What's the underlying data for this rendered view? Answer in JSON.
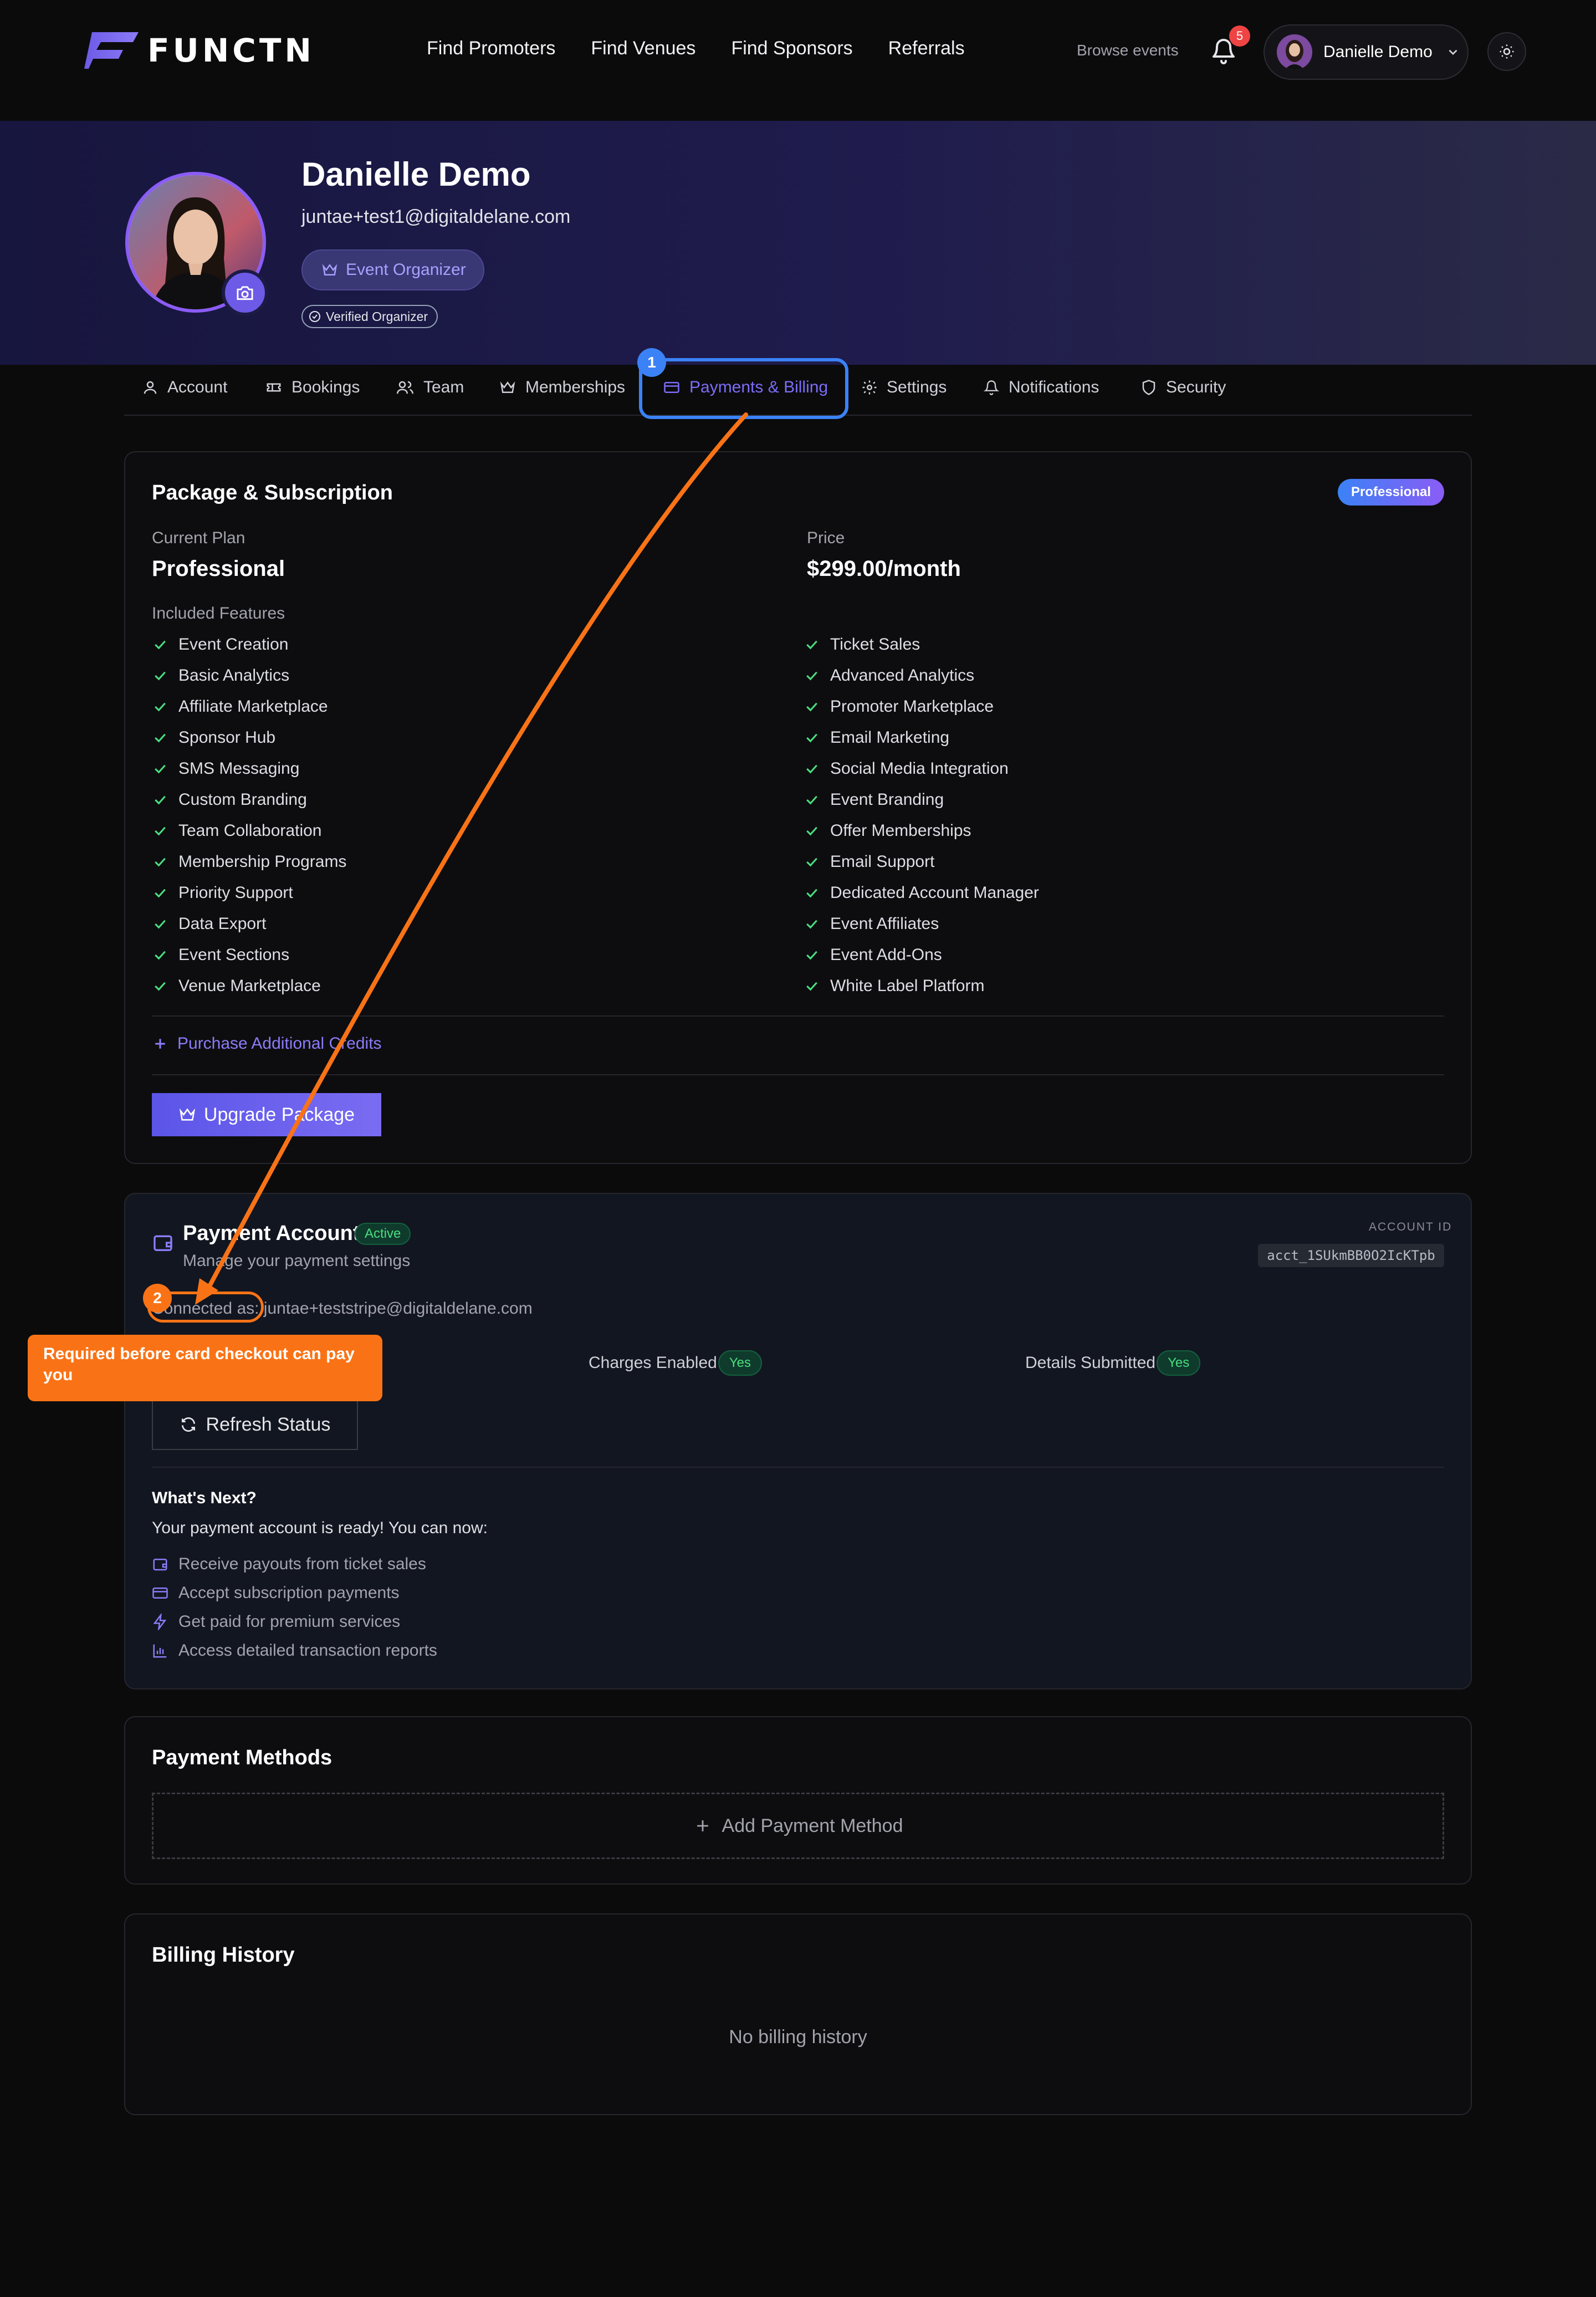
{
  "brand": {
    "name": "FUNCTN"
  },
  "nav": {
    "links": [
      "Find Promoters",
      "Find Venues",
      "Find Sponsors",
      "Referrals"
    ],
    "browse": "Browse events",
    "notifications_count": "5",
    "user_name": "Danielle Demo"
  },
  "profile": {
    "name": "Danielle Demo",
    "email": "juntae+test1@digitaldelane.com",
    "role": "Event Organizer",
    "verified": "Verified Organizer"
  },
  "tabs": [
    "Account",
    "Bookings",
    "Team",
    "Memberships",
    "Payments & Billing",
    "Settings",
    "Notifications",
    "Security"
  ],
  "active_tab": "Payments & Billing",
  "package": {
    "title": "Package & Subscription",
    "badge": "Professional",
    "current_plan_label": "Current Plan",
    "current_plan": "Professional",
    "price_label": "Price",
    "price": "$299.00/month",
    "features_label": "Included Features",
    "features_left": [
      "Event Creation",
      "Basic Analytics",
      "Affiliate Marketplace",
      "Sponsor Hub",
      "SMS Messaging",
      "Custom Branding",
      "Team Collaboration",
      "Membership Programs",
      "Priority Support",
      "Data Export",
      "Event Sections",
      "Venue Marketplace"
    ],
    "features_right": [
      "Ticket Sales",
      "Advanced Analytics",
      "Promoter Marketplace",
      "Email Marketing",
      "Social Media Integration",
      "Event Branding",
      "Offer Memberships",
      "Email Support",
      "Dedicated Account Manager",
      "Event Affiliates",
      "Event Add-Ons",
      "White Label Platform"
    ],
    "credits_link": "Purchase Additional Credits",
    "upgrade_button": "Upgrade Package"
  },
  "payment_account": {
    "title": "Payment Account",
    "status": "Active",
    "subtitle": "Manage your payment settings",
    "account_id_label": "ACCOUNT ID",
    "account_id": "acct_1SUkmBB0O2IcKTpb",
    "connected": "Connected as: juntae+teststripe@digitaldelane.com",
    "charges_label": "Charges Enabled",
    "charges_value": "Yes",
    "details_label": "Details Submitted",
    "details_value": "Yes",
    "refresh_button": "Refresh Status",
    "next_title": "What's Next?",
    "next_subtitle": "Your payment account is ready! You can now:",
    "next_items": [
      "Receive payouts from ticket sales",
      "Accept subscription payments",
      "Get paid for premium services",
      "Access detailed transaction reports"
    ]
  },
  "payment_methods": {
    "title": "Payment Methods",
    "add_button": "Add Payment Method"
  },
  "billing_history": {
    "title": "Billing History",
    "empty": "No billing history"
  },
  "annotations": {
    "step1": "1",
    "step2": "2",
    "callout": "Required before card checkout can pay you",
    "colors": {
      "step1": "#3b82f6",
      "step2": "#f97316"
    }
  }
}
